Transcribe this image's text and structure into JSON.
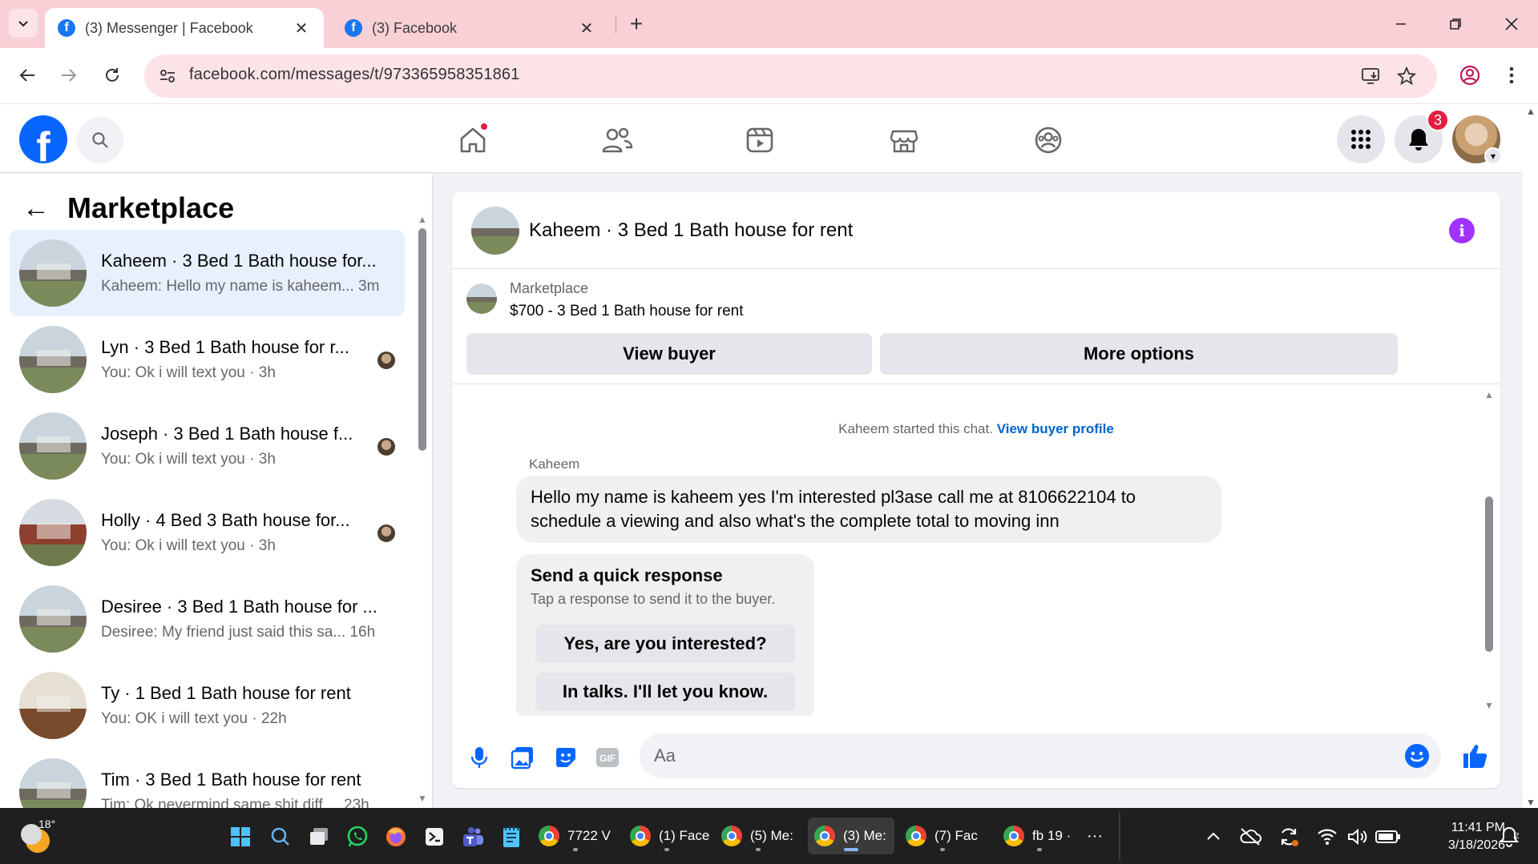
{
  "browser": {
    "tabs": [
      {
        "title": "(3) Messenger | Facebook",
        "active": true
      },
      {
        "title": "(3) Facebook",
        "active": false
      }
    ],
    "url": "facebook.com/messages/t/973365958351861"
  },
  "header": {
    "notification_count": "3",
    "nav_icons": [
      "home-icon",
      "friends-icon",
      "video-icon",
      "marketplace-icon",
      "groups-icon"
    ]
  },
  "sidebar": {
    "title": "Marketplace",
    "conversations": [
      {
        "name": "Kaheem · 3 Bed 1 Bath house for...",
        "preview": "Kaheem: Hello my name is kaheem...",
        "time": "3m",
        "active": true,
        "thumb": "house"
      },
      {
        "name": "Lyn · 3 Bed 1 Bath house for r...",
        "preview": "You: Ok i will text you",
        "time": "3h",
        "thumb": "house"
      },
      {
        "name": "Joseph · 3 Bed 1 Bath house f...",
        "preview": "You: Ok i will text you",
        "time": "3h",
        "thumb": "house"
      },
      {
        "name": "Holly · 4 Bed 3 Bath house for...",
        "preview": "You: Ok i will text you",
        "time": "3h",
        "thumb": "brick"
      },
      {
        "name": "Desiree · 3 Bed 1 Bath house for ...",
        "preview": "Desiree: My friend just said this sa...",
        "time": "16h",
        "thumb": "house"
      },
      {
        "name": "Ty · 1 Bed 1 Bath house for rent",
        "preview": "You: OK i will text you",
        "time": "22h",
        "thumb": "room"
      },
      {
        "name": "Tim · 3 Bed 1 Bath house for rent",
        "preview": "Tim: Ok nevermind same shit diff ...",
        "time": "23h",
        "thumb": "house"
      }
    ]
  },
  "chat": {
    "title": "Kaheem · 3 Bed 1 Bath house for rent",
    "listing_label": "Marketplace",
    "listing_title": "$700 - 3 Bed 1 Bath house for rent",
    "view_buyer_label": "View buyer",
    "more_options_label": "More options",
    "started_text": "Kaheem started this chat.",
    "view_buyer_profile_label": "View buyer profile",
    "sender": "Kaheem",
    "message": "Hello my name is kaheem yes I'm interested pl3ase call me at 8106622104 to schedule a viewing and also what's the complete total to moving inn",
    "quick_response": {
      "title": "Send a quick response",
      "subtitle": "Tap a response to send it to the buyer.",
      "options": [
        "Yes, are you interested?",
        "In talks. I'll let you know."
      ]
    },
    "composer_placeholder": "Aa"
  },
  "taskbar": {
    "weather_temp": "18°",
    "apps": [
      {
        "label": "7722 V",
        "active": false
      },
      {
        "label": "(1) Face",
        "active": false
      },
      {
        "label": "(5) Me:",
        "active": false
      },
      {
        "label": "(3) Me:",
        "active": true
      },
      {
        "label": "(7) Fac",
        "active": false
      },
      {
        "label": "fb 19 ·",
        "active": false
      }
    ],
    "more_label": "···",
    "time": "11:41 PM",
    "date": "3/18/2026"
  },
  "colors": {
    "brand": "#0866ff",
    "tabstrip": "#f9d0d6",
    "active_conversation": "#e7f0fd",
    "info_purple": "#a033ff",
    "link": "#0064d1"
  }
}
